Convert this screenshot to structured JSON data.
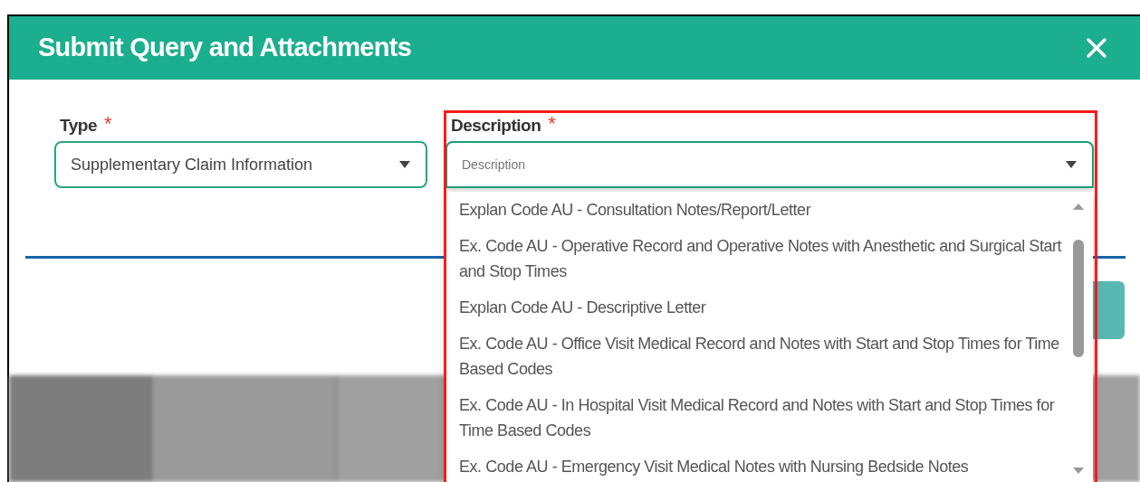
{
  "dialog": {
    "title": "Submit Query and Attachments"
  },
  "fields": [
    {
      "kind": "select",
      "label": "Type",
      "required_mark": "*",
      "value": "Supplementary Claim Information",
      "focused": false
    },
    {
      "kind": "select",
      "label": "Description",
      "required_mark": "*",
      "placeholder": "Description",
      "focused": true
    }
  ],
  "dropdown": {
    "options": [
      "Explan Code AU - Consultation Notes/Report/Letter",
      "Ex. Code AU - Operative Record and Operative Notes with Anesthetic and Surgical Start and Stop Times",
      "Explan Code AU - Descriptive Letter",
      "Ex. Code AU - Office Visit Medical Record and Notes with Start and Stop Times for Time Based Codes",
      "Ex. Code AU - In Hospital Visit Medical Record and Notes with Start and Stop Times for Time Based Codes",
      "Ex. Code AU - Emergency Visit Medical Notes with Nursing Bedside Notes"
    ]
  }
}
